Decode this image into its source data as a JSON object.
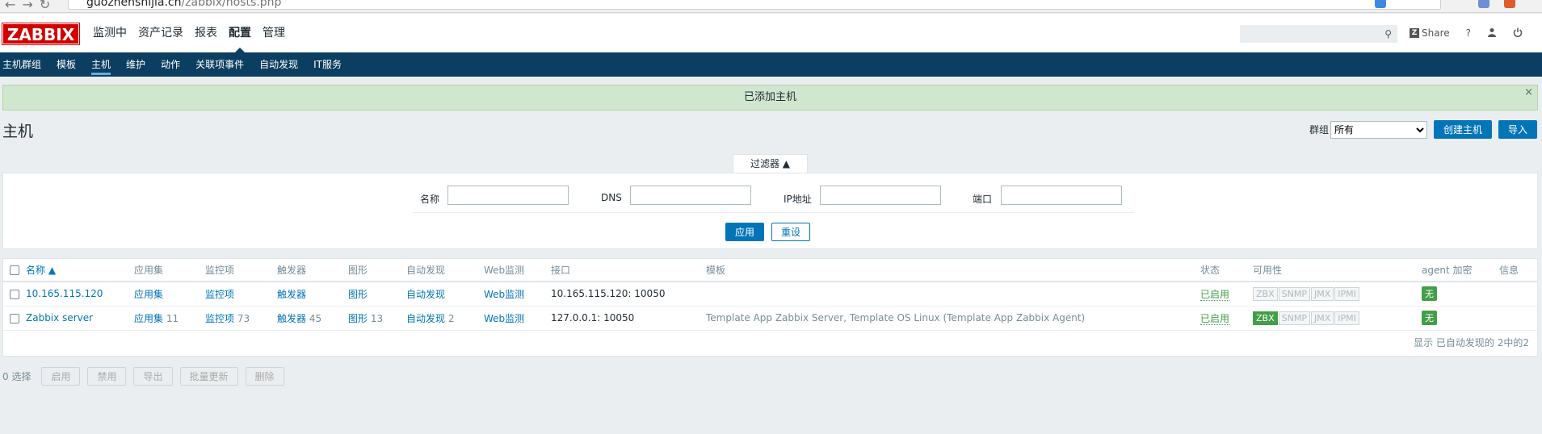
{
  "browser": {
    "url_host": "guozhenshijia.cn",
    "url_path": "/zabbix/hosts.php"
  },
  "header": {
    "logo": "ZABBIX",
    "menu": [
      {
        "label": "监测中",
        "active": false
      },
      {
        "label": "资产记录",
        "active": false
      },
      {
        "label": "报表",
        "active": false
      },
      {
        "label": "配置",
        "active": true
      },
      {
        "label": "管理",
        "active": false
      }
    ],
    "search_placeholder": "",
    "share_label": "Share",
    "help_icon": "?",
    "user_icon": "user-icon",
    "power_icon": "power-icon"
  },
  "subnav": [
    {
      "label": "主机群组",
      "active": false
    },
    {
      "label": "模板",
      "active": false
    },
    {
      "label": "主机",
      "active": true
    },
    {
      "label": "维护",
      "active": false
    },
    {
      "label": "动作",
      "active": false
    },
    {
      "label": "关联项事件",
      "active": false
    },
    {
      "label": "自动发现",
      "active": false
    },
    {
      "label": "IT服务",
      "active": false
    }
  ],
  "message": {
    "text": "已添加主机",
    "close": "×"
  },
  "page": {
    "title": "主机",
    "group_label": "群组",
    "group_value": "所有",
    "create_button": "创建主机",
    "import_button": "导入"
  },
  "filter": {
    "tab_label": "过滤器 ▲",
    "fields": [
      {
        "label": "名称",
        "value": ""
      },
      {
        "label": "DNS",
        "value": ""
      },
      {
        "label": "IP地址",
        "value": ""
      },
      {
        "label": "端口",
        "value": ""
      }
    ],
    "apply_button": "应用",
    "reset_button": "重设"
  },
  "table": {
    "columns": [
      "名称 ▲",
      "应用集",
      "监控项",
      "触发器",
      "图形",
      "自动发现",
      "Web监测",
      "接口",
      "模板",
      "状态",
      "可用性",
      "agent 加密",
      "信息"
    ],
    "rows": [
      {
        "name": "10.165.115.120",
        "apps": "应用集",
        "apps_count": "",
        "items": "监控项",
        "items_count": "",
        "triggers": "触发器",
        "triggers_count": "",
        "graphs": "图形",
        "graphs_count": "",
        "discovery": "自动发现",
        "discovery_count": "",
        "web": "Web监测",
        "interface": "10.165.115.120: 10050",
        "templates": "",
        "status": "已启用",
        "availability": [
          {
            "label": "ZBX",
            "on": false
          },
          {
            "label": "SNMP",
            "on": false
          },
          {
            "label": "JMX",
            "on": false
          },
          {
            "label": "IPMI",
            "on": false
          }
        ],
        "encryption": "无"
      },
      {
        "name": "Zabbix server",
        "apps": "应用集",
        "apps_count": "11",
        "items": "监控项",
        "items_count": "73",
        "triggers": "触发器",
        "triggers_count": "45",
        "graphs": "图形",
        "graphs_count": "13",
        "discovery": "自动发现",
        "discovery_count": "2",
        "web": "Web监测",
        "interface": "127.0.0.1: 10050",
        "templates": "Template App Zabbix Server, Template OS Linux (Template App Zabbix Agent)",
        "status": "已启用",
        "availability": [
          {
            "label": "ZBX",
            "on": true
          },
          {
            "label": "SNMP",
            "on": false
          },
          {
            "label": "JMX",
            "on": false
          },
          {
            "label": "IPMI",
            "on": false
          }
        ],
        "encryption": "无"
      }
    ],
    "footer": "显示 已自动发现的 2中的2"
  },
  "actions": {
    "selected": "0 选择",
    "buttons": [
      "启用",
      "禁用",
      "导出",
      "批量更新",
      "删除"
    ]
  },
  "colors": {
    "brand_red": "#d40000",
    "nav_blue": "#0b3e61",
    "link_blue": "#0275b8",
    "green": "#429e47",
    "message_bg": "#d1e6cf"
  }
}
